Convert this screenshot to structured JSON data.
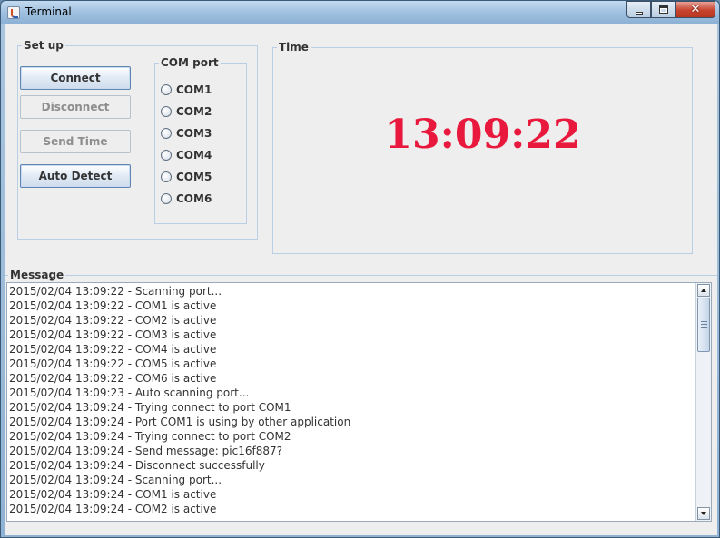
{
  "window": {
    "title": "Terminal"
  },
  "setup": {
    "title": "Set up",
    "buttons": [
      {
        "label": "Connect",
        "enabled": true
      },
      {
        "label": "Disconnect",
        "enabled": false
      },
      {
        "label": "Send Time",
        "enabled": false
      },
      {
        "label": "Auto Detect",
        "enabled": true
      }
    ],
    "com_port": {
      "title": "COM port",
      "options": [
        "COM1",
        "COM2",
        "COM3",
        "COM4",
        "COM5",
        "COM6"
      ]
    }
  },
  "time_panel": {
    "title": "Time",
    "clock": "13:09:22"
  },
  "message_panel": {
    "title": "Message",
    "lines": [
      "2015/02/04 13:09:22 - Scanning port...",
      "2015/02/04 13:09:22 - COM1 is active",
      "2015/02/04 13:09:22 - COM2 is active",
      "2015/02/04 13:09:22 - COM3 is active",
      "2015/02/04 13:09:22 - COM4 is active",
      "2015/02/04 13:09:22 - COM5 is active",
      "2015/02/04 13:09:22 - COM6 is active",
      "2015/02/04 13:09:23 - Auto scanning port...",
      "2015/02/04 13:09:24 - Trying connect to port COM1",
      "2015/02/04 13:09:24 - Port COM1 is using by other application",
      "2015/02/04 13:09:24 - Trying connect to port COM2",
      "2015/02/04 13:09:24 - Send message: pic16f887?",
      "2015/02/04 13:09:24 - Disconnect successfully",
      "2015/02/04 13:09:24 - Scanning port...",
      "2015/02/04 13:09:24 - COM1 is active",
      "2015/02/04 13:09:24 - COM2 is active"
    ]
  },
  "colors": {
    "clock": "#e8193c",
    "border": "#b8cfe5"
  }
}
